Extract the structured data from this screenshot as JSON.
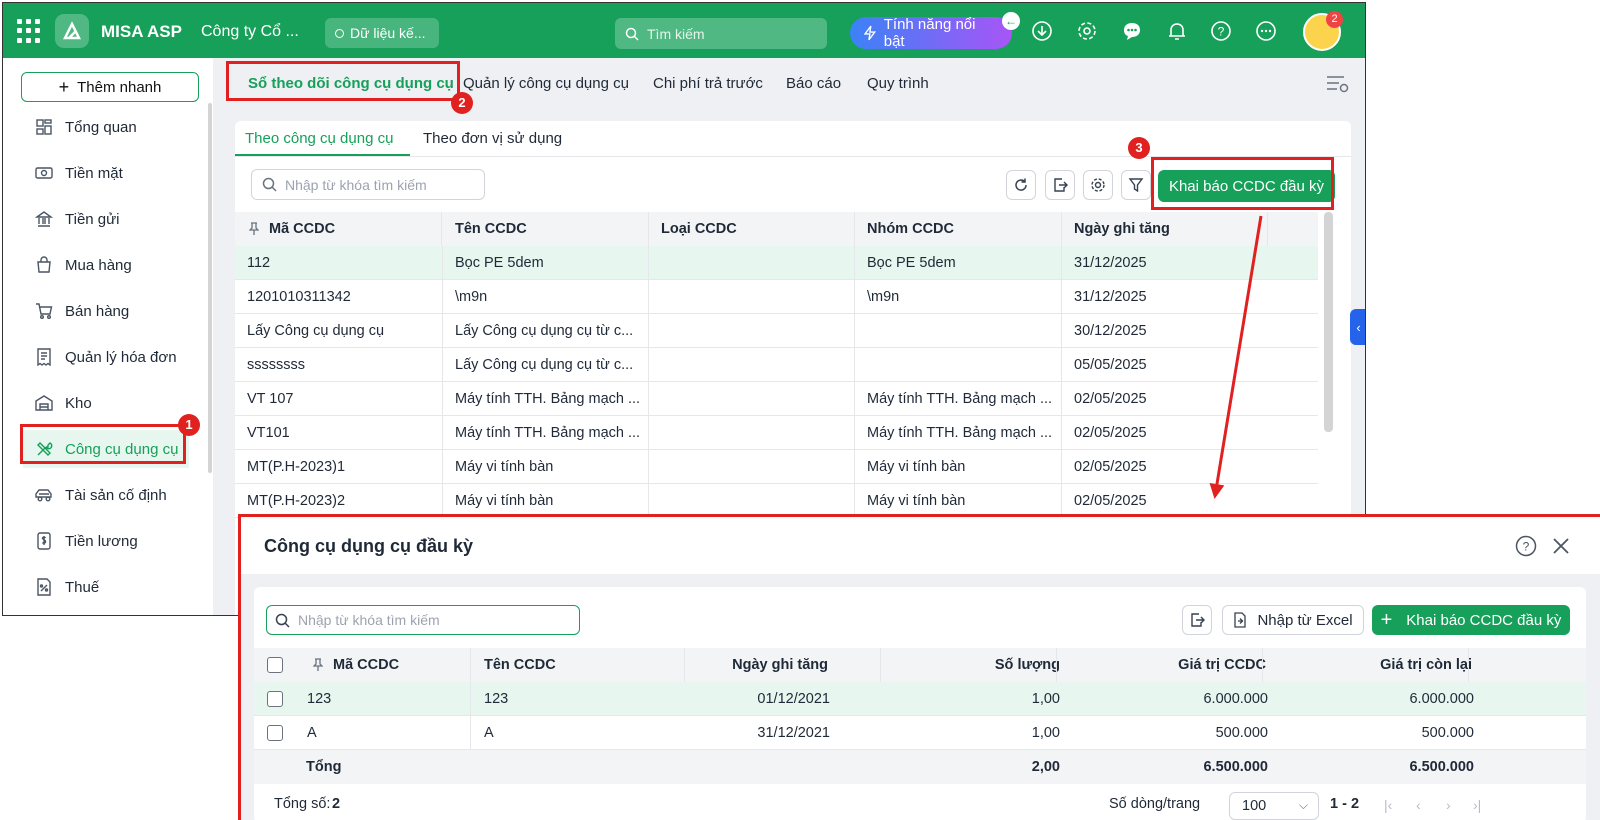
{
  "topbar": {
    "app_name": "MISA ASP",
    "company": "Công ty Cổ ...",
    "data_pill": "Dữ liệu kế...",
    "search_placeholder": "Tìm kiếm",
    "feature_button": "Tính năng nổi bật",
    "notification_count": "2"
  },
  "sidebar": {
    "quick_add": "Thêm nhanh",
    "items": [
      {
        "label": "Tổng quan",
        "icon": "dashboard-icon"
      },
      {
        "label": "Tiền mặt",
        "icon": "cash-icon"
      },
      {
        "label": "Tiền gửi",
        "icon": "bank-icon"
      },
      {
        "label": "Mua hàng",
        "icon": "shopping-bag-icon"
      },
      {
        "label": "Bán hàng",
        "icon": "cart-icon"
      },
      {
        "label": "Quản lý hóa đơn",
        "icon": "invoice-icon"
      },
      {
        "label": "Kho",
        "icon": "warehouse-icon"
      },
      {
        "label": "Công cụ dụng cụ",
        "icon": "tools-icon",
        "active": true
      },
      {
        "label": "Tài sản cố định",
        "icon": "car-icon"
      },
      {
        "label": "Tiền lương",
        "icon": "salary-icon"
      },
      {
        "label": "Thuế",
        "icon": "tax-icon"
      }
    ]
  },
  "main_tabs": [
    "Sổ theo dõi công cụ dụng cụ",
    "Quản lý công cụ dụng cụ",
    "Chi phí trả trước",
    "Báo cáo",
    "Quy trình"
  ],
  "sub_tabs": [
    "Theo công cụ dụng cụ",
    "Theo đơn vị sử dụng"
  ],
  "panel": {
    "search_placeholder": "Nhập từ khóa tìm kiếm",
    "declare_button": "Khai báo CCDC đầu kỳ"
  },
  "grid": {
    "columns": [
      "Mã CCDC",
      "Tên CCDC",
      "Loại CCDC",
      "Nhóm CCDC",
      "Ngày ghi tăng"
    ],
    "rows": [
      [
        "112",
        "Bọc PE 5dem",
        "",
        "Bọc PE 5dem",
        "31/12/2025"
      ],
      [
        "1201010311342",
        "\\m9n",
        "",
        "\\m9n",
        "31/12/2025"
      ],
      [
        "Lấy Công cụ dụng cụ",
        "Lấy Công cụ dụng cụ từ c...",
        "",
        "",
        "30/12/2025"
      ],
      [
        "ssssssss",
        "Lấy Công cụ dụng cụ từ c...",
        "",
        "",
        "05/05/2025"
      ],
      [
        "VT 107",
        "Máy tính TTH. Bảng mạch ...",
        "",
        "Máy tính TTH. Bảng mạch ...",
        "02/05/2025"
      ],
      [
        "VT101",
        "Máy tính TTH. Bảng mạch ...",
        "",
        "Máy tính TTH. Bảng mạch ...",
        "02/05/2025"
      ],
      [
        "MT(P.H-2023)1",
        "Máy vi tính bàn",
        "",
        "Máy vi tính bàn",
        "02/05/2025"
      ],
      [
        "MT(P.H-2023)2",
        "Máy vi tính bàn",
        "",
        "Máy vi tính bàn",
        "02/05/2025"
      ]
    ]
  },
  "annotations": [
    "1",
    "2",
    "3"
  ],
  "dialog": {
    "title": "Công cụ dụng cụ đầu kỳ",
    "search_placeholder": "Nhập từ khóa tìm kiếm",
    "import_excel": "Nhập từ Excel",
    "add_button": "Khai báo CCDC đầu kỳ",
    "columns": [
      "Mã CCDC",
      "Tên CCDC",
      "Ngày ghi tăng",
      "Số lượng",
      "Giá trị CCDC",
      "Giá trị còn lại"
    ],
    "rows": [
      [
        "123",
        "123",
        "01/12/2021",
        "1,00",
        "6.000.000",
        "6.000.000"
      ],
      [
        "A",
        "A",
        "31/12/2021",
        "1,00",
        "500.000",
        "500.000"
      ]
    ],
    "total": {
      "label": "Tổng",
      "quantity": "2,00",
      "value": "6.500.000",
      "remaining": "6.500.000"
    },
    "footer": {
      "total_label": "Tổng số:",
      "total_count": "2",
      "rows_per_page_label": "Số dòng/trang",
      "rows_per_page": "100",
      "range": "1 - 2"
    }
  },
  "colors": {
    "brand_green": "#16a05a",
    "annotation_red": "#e12020",
    "accent_blue": "#2563eb"
  }
}
